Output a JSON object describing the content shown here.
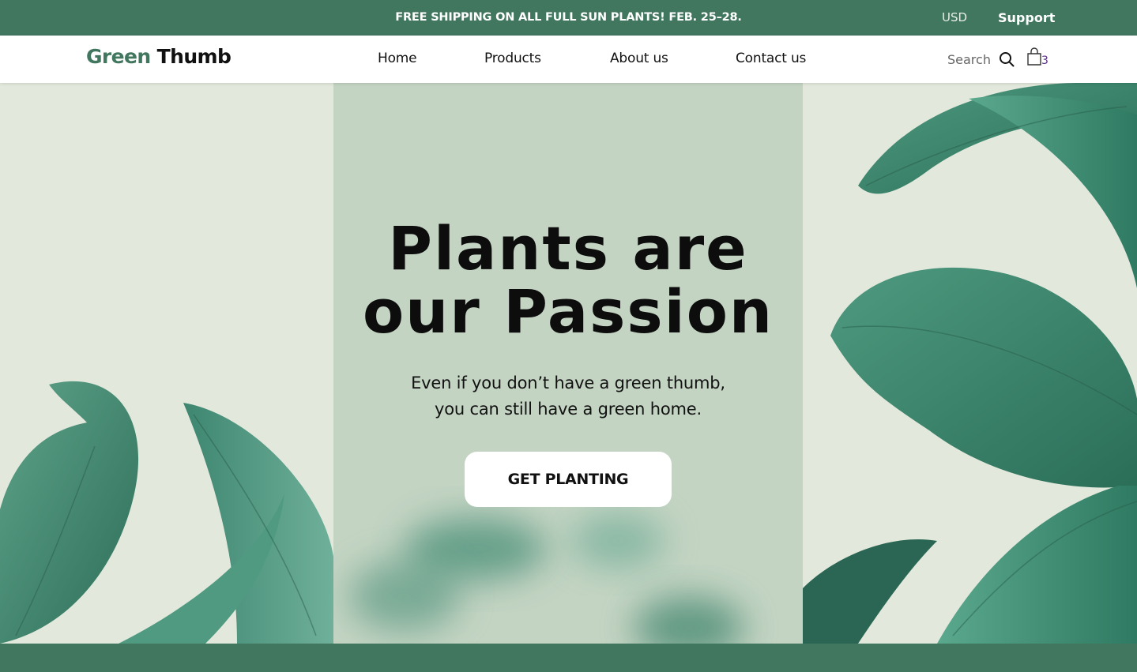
{
  "announcement": {
    "message": "FREE SHIPPING ON ALL FULL SUN PLANTS! FEB. 25–28.",
    "currency": "USD",
    "support": "Support"
  },
  "brand": {
    "part1": "Green",
    "part2": "Thumb"
  },
  "nav": {
    "items": [
      {
        "label": "Home"
      },
      {
        "label": "Products"
      },
      {
        "label": "About us"
      },
      {
        "label": "Contact us"
      }
    ],
    "search_label": "Search",
    "cart_count": "3"
  },
  "hero": {
    "headline_line1": "Plants are",
    "headline_line2": "our Passion",
    "subline_line1": "Even if you don’t have a green thumb,",
    "subline_line2": "you can still have a green home.",
    "cta_label": "GET PLANTING"
  },
  "colors": {
    "brand_green": "#41765f",
    "hero_center": "#c4d4c3",
    "hero_side": "#e2e9dc",
    "leaf": "#3f8a72",
    "cart_count": "#5a2d86"
  },
  "icons": {
    "search": "search-icon",
    "cart": "shopping-bag-icon"
  }
}
